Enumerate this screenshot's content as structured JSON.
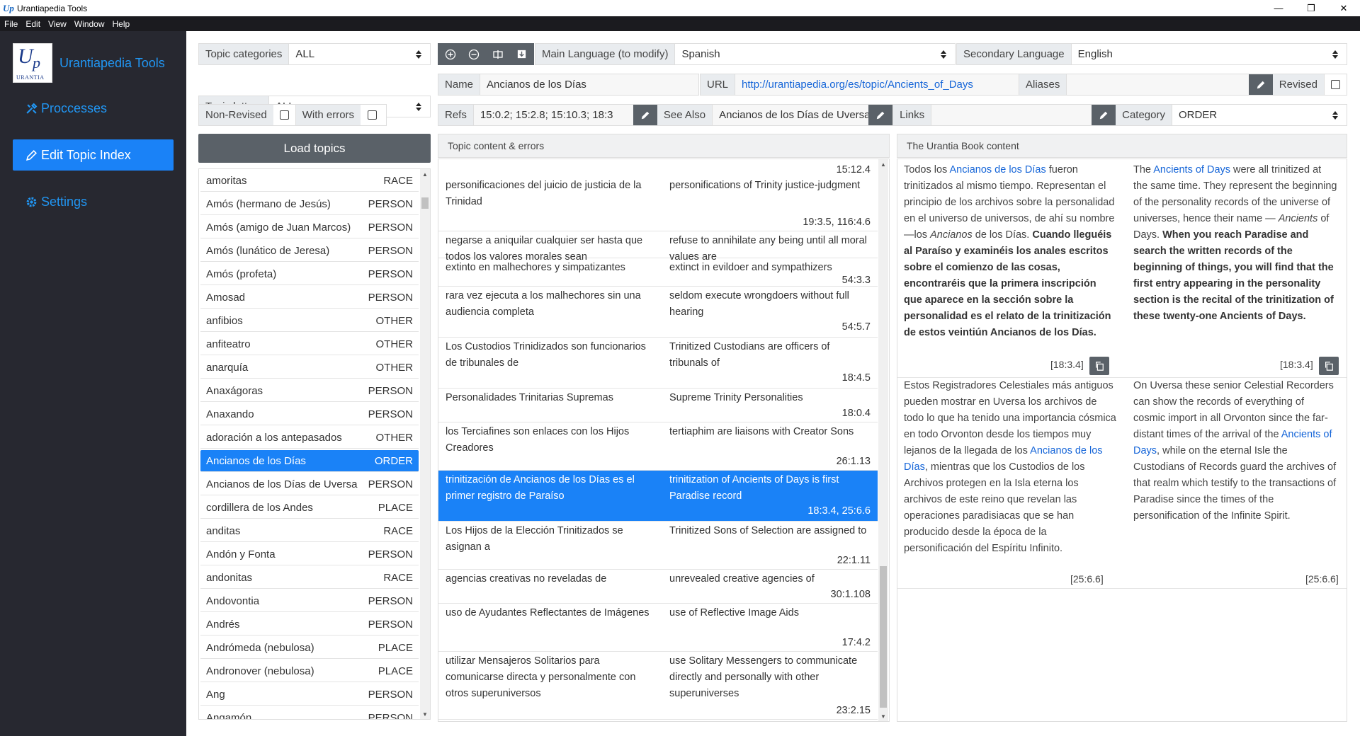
{
  "window": {
    "title": "Urantiapedia Tools",
    "logo_char": "Up",
    "controls": [
      "—",
      "❐",
      "✕"
    ]
  },
  "menu": [
    "File",
    "Edit",
    "View",
    "Window",
    "Help"
  ],
  "sidebar": {
    "app_name": "Urantiapedia Tools",
    "logo": {
      "letter_u": "U",
      "letter_p": "p",
      "word": "URANTIA"
    },
    "items": [
      {
        "label": "Proccesses",
        "icon": "tools-icon"
      },
      {
        "label": "Edit Topic Index",
        "icon": "pencil-icon",
        "active": true
      },
      {
        "label": "Settings",
        "icon": "gear-icon"
      }
    ]
  },
  "filters": {
    "categories_label": "Topic categories",
    "categories_value": "ALL",
    "letters_label": "Topic letters",
    "letters_value": "ALL",
    "nonrevised_label": "Non-Revised",
    "witherrors_label": "With errors"
  },
  "toolbar": {
    "main_lang_label": "Main Language (to modify)",
    "main_lang_value": "Spanish",
    "sec_lang_label": "Secondary Language",
    "sec_lang_value": "English"
  },
  "topic": {
    "name_label": "Name",
    "name_value": "Ancianos de los Días",
    "url_label": "URL",
    "url_value": "http://urantiapedia.org/es/topic/Ancients_of_Days",
    "aliases_label": "Aliases",
    "revised_label": "Revised",
    "refs_label": "Refs",
    "refs_value": "15:0.2; 15:2.8; 15:10.3; 18:3",
    "seealso_label": "See Also",
    "seealso_value": "Ancianos de los Días de Uversa",
    "links_label": "Links",
    "category_label": "Category",
    "category_value": "ORDER"
  },
  "load_button": "Load topics",
  "topics": [
    {
      "name": "amoritas",
      "type": "RACE"
    },
    {
      "name": "Amós (hermano de Jesús)",
      "type": "PERSON"
    },
    {
      "name": "Amós (amigo de Juan Marcos)",
      "type": "PERSON"
    },
    {
      "name": "Amós (lunático de Jeresa)",
      "type": "PERSON"
    },
    {
      "name": "Amós (profeta)",
      "type": "PERSON"
    },
    {
      "name": "Amosad",
      "type": "PERSON"
    },
    {
      "name": "anfibios",
      "type": "OTHER"
    },
    {
      "name": "anfiteatro",
      "type": "OTHER"
    },
    {
      "name": "anarquía",
      "type": "OTHER"
    },
    {
      "name": "Anaxágoras",
      "type": "PERSON"
    },
    {
      "name": "Anaxando",
      "type": "PERSON"
    },
    {
      "name": "adoración a los antepasados",
      "type": "OTHER"
    },
    {
      "name": "Ancianos de los Días",
      "type": "ORDER",
      "selected": true
    },
    {
      "name": "Ancianos de los Días de Uversa",
      "type": "PERSON"
    },
    {
      "name": "cordillera de los Andes",
      "type": "PLACE"
    },
    {
      "name": "anditas",
      "type": "RACE"
    },
    {
      "name": "Andón y Fonta",
      "type": "PERSON"
    },
    {
      "name": "andonitas",
      "type": "RACE"
    },
    {
      "name": "Andovontia",
      "type": "PERSON"
    },
    {
      "name": "Andrés",
      "type": "PERSON"
    },
    {
      "name": "Andrómeda (nebulosa)",
      "type": "PLACE"
    },
    {
      "name": "Andronover (nebulosa)",
      "type": "PLACE"
    },
    {
      "name": "Ang",
      "type": "PERSON"
    },
    {
      "name": "Angamón",
      "type": "PERSON"
    }
  ],
  "content_header": "Topic content & errors",
  "content_top_ref": "15:12.4",
  "content": [
    {
      "es": "personificaciones del juicio de justicia de la Trinidad",
      "en": "personifications of Trinity justice-judgment",
      "ref": "19:3.5, 116:4.6"
    },
    {
      "es": "negarse a aniquilar cualquier ser hasta que todos los valores morales sean",
      "en": "refuse to annihilate any being until all moral values are",
      "ref": ""
    },
    {
      "es": "extinto en malhechores y simpatizantes",
      "en": "extinct in evildoer and sympathizers",
      "ref": "54:3.3"
    },
    {
      "es": "rara vez ejecuta a los malhechores sin una audiencia completa",
      "en": "seldom execute wrongdoers without full hearing",
      "ref": "54:5.7"
    },
    {
      "es": "Los Custodios Trinidizados son funcionarios de tribunales de",
      "en": "Trinitized Custodians are officers of tribunals of",
      "ref": "18:4.5"
    },
    {
      "es": "Personalidades Trinitarias Supremas",
      "en": "Supreme Trinity Personalities",
      "ref": "18:0.4"
    },
    {
      "es": "los Terciafines son enlaces con los Hijos Creadores",
      "en": "tertiaphim are liaisons with Creator Sons",
      "ref": "26:1.13"
    },
    {
      "es": "trinitización de Ancianos de los Días es el primer registro de Paraíso",
      "en": "trinitization of Ancients of Days is first Paradise record",
      "ref": "18:3.4, 25:6.6",
      "selected": true
    },
    {
      "es": "Los Hijos de la Elección Trinitizados se asignan a",
      "en": "Trinitized Sons of Selection are assigned to",
      "ref": "22:1.11"
    },
    {
      "es": "agencias creativas no reveladas de",
      "en": "unrevealed creative agencies of",
      "ref": "30:1.108"
    },
    {
      "es": "uso de Ayudantes Reflectantes de Imágenes",
      "en": "use of Reflective Image Aids",
      "ref": "17:4.2"
    },
    {
      "es": "utilizar Mensajeros Solitarios para comunicarse directa y personalmente con otros superuniversos",
      "en": "use Solitary Messengers to communicate directly and personally with other superuniverses",
      "ref": "23:2.15"
    }
  ],
  "ub_header": "The Urantia Book content",
  "ub": {
    "p1_es": {
      "t1": "Todos los ",
      "l1": "Ancianos de los Días",
      "t2": " fueron trinitizados al mismo tiempo. Representan el principio de los archivos sobre la personalidad en el universo de universos, de ahí su nombre —los ",
      "i1": "Ancianos",
      "t3": " de los Días. ",
      "b1": "Cuando lleguéis al Paraíso y examinéis los anales escritos sobre el comienzo de las cosas, encontraréis que la primera inscripción que aparece en la sección sobre la personalidad es el relato de la trinitización de estos veintiún Ancianos de los Días.",
      "ref": "[18:3.4]"
    },
    "p1_en": {
      "t1": "The ",
      "l1": "Ancients of Days",
      "t2": " were all trinitized at the same time. They represent the beginning of the personality records of the universe of universes, hence their name — ",
      "i1": "Ancients",
      "t3": " of Days. ",
      "b1": "When you reach Paradise and search the written records of the beginning of things, you will find that the first entry appearing in the personality section is the recital of the trinitization of these twenty-one Ancients of Days.",
      "ref": "[18:3.4]"
    },
    "p2_es": {
      "t1": "Estos Registradores Celestiales más antiguos pueden mostrar en Uversa los archivos de todo lo que ha tenido una importancia cósmica en todo Orvonton desde los tiempos muy lejanos de la llegada de los ",
      "l1": "Ancianos de los Días",
      "t2": ", mientras que los Custodios de los Archivos protegen en la Isla eterna los archivos de este reino que revelan las operaciones paradisiacas que se han producido desde la época de la personificación del Espíritu Infinito.",
      "ref": "[25:6.6]"
    },
    "p2_en": {
      "t1": "On Uversa these senior Celestial Recorders can show the records of everything of cosmic import in all Orvonton since the far-distant times of the arrival of the ",
      "l1": "Ancients of Days",
      "t2": ", while on the eternal Isle the Custodians of Records guard the archives of that realm which testify to the transactions of Paradise since the times of the personification of the Infinite Spirit.",
      "ref": "[25:6.6]"
    }
  },
  "colors": {
    "accent": "#1a82f7",
    "sidebar": "#272830",
    "button": "#5a6168",
    "link": "#1565d8"
  }
}
